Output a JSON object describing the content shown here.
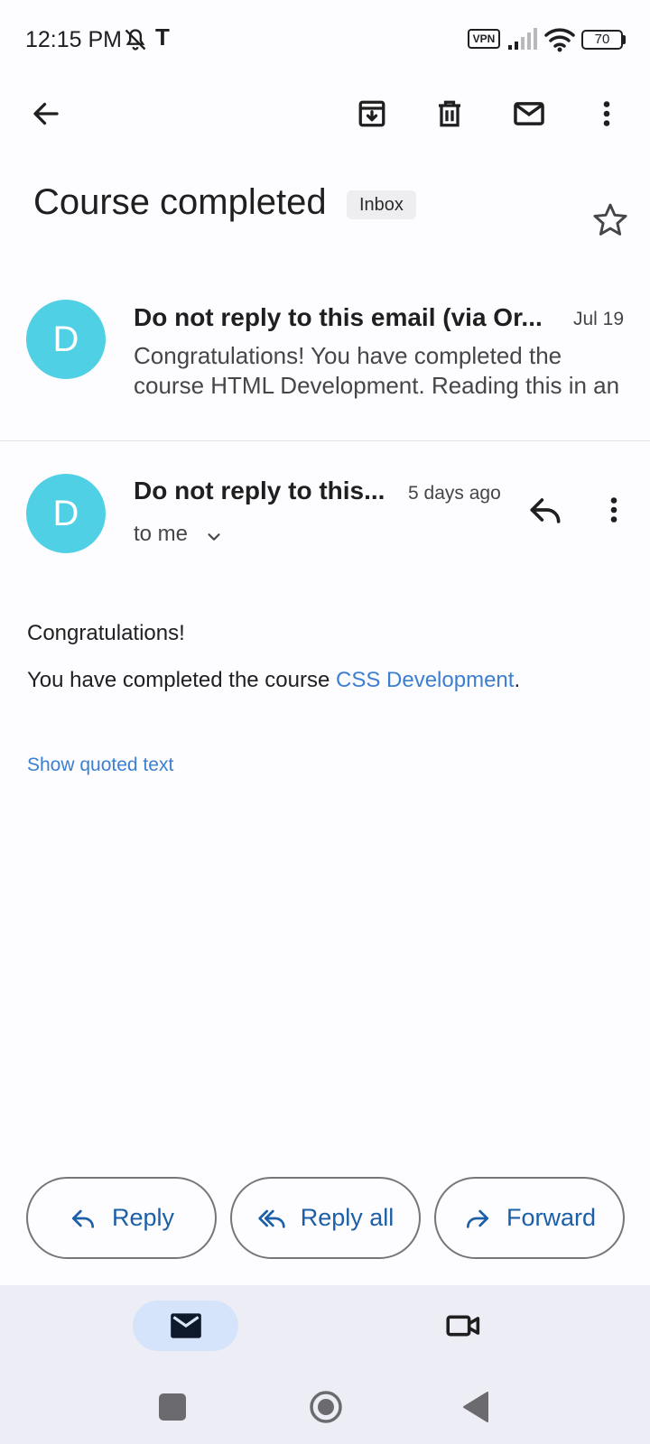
{
  "status_bar": {
    "time": "12:15 PM",
    "carrier_glyph": "T",
    "vpn": "VPN",
    "battery": "70"
  },
  "toolbar": {
    "icons": [
      "back-icon",
      "archive-icon",
      "delete-icon",
      "mark-unread-icon",
      "more-vert-icon"
    ]
  },
  "thread": {
    "subject": "Course completed",
    "label": "Inbox"
  },
  "messages": [
    {
      "avatar_letter": "D",
      "sender": "Do not reply to this email  (via Or...",
      "date": "Jul 19",
      "snippet": "Congratulations! You have completed the course HTML Development. Reading this in an"
    },
    {
      "avatar_letter": "D",
      "sender": "Do not reply to this...",
      "time": "5 days ago",
      "recipient": "to me",
      "body": {
        "greeting": "Congratulations!",
        "line_prefix": "You have completed the course ",
        "link_text": "CSS Development",
        "line_suffix": "."
      },
      "show_quoted": "Show quoted text"
    }
  ],
  "actions": {
    "reply": "Reply",
    "reply_all": "Reply all",
    "forward": "Forward"
  },
  "colors": {
    "avatar": "#4fd0e5",
    "link": "#3c7fd1",
    "action_text": "#1b5fa8",
    "nav_bg": "#edeef5",
    "nav_active_pill": "#d6e4fb"
  }
}
